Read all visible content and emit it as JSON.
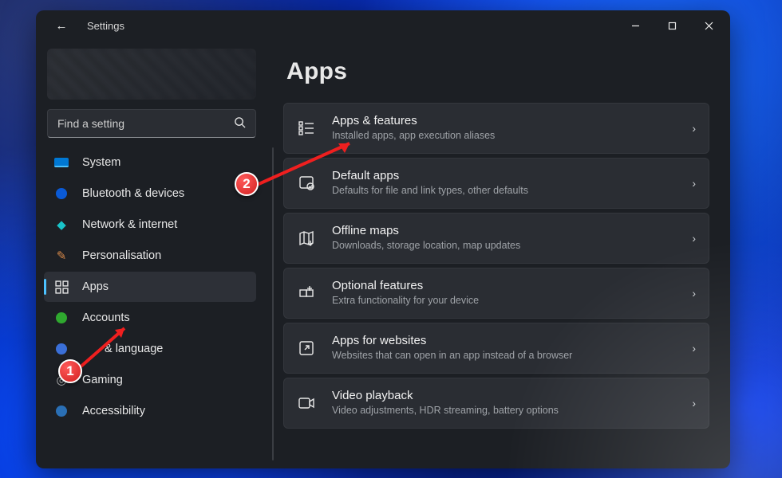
{
  "window": {
    "title": "Settings"
  },
  "search": {
    "placeholder": "Find a setting"
  },
  "sidebar": {
    "items": [
      {
        "label": "System"
      },
      {
        "label": "Bluetooth & devices"
      },
      {
        "label": "Network & internet"
      },
      {
        "label": "Personalisation"
      },
      {
        "label": "Apps"
      },
      {
        "label": "Accounts"
      },
      {
        "label": "Time & language"
      },
      {
        "label": "Gaming"
      },
      {
        "label": "Accessibility"
      }
    ],
    "partial_label_time": "& language",
    "selected_index": 4
  },
  "main": {
    "heading": "Apps",
    "cards": [
      {
        "title": "Apps & features",
        "subtitle": "Installed apps, app execution aliases"
      },
      {
        "title": "Default apps",
        "subtitle": "Defaults for file and link types, other defaults"
      },
      {
        "title": "Offline maps",
        "subtitle": "Downloads, storage location, map updates"
      },
      {
        "title": "Optional features",
        "subtitle": "Extra functionality for your device"
      },
      {
        "title": "Apps for websites",
        "subtitle": "Websites that can open in an app instead of a browser"
      },
      {
        "title": "Video playback",
        "subtitle": "Video adjustments, HDR streaming, battery options"
      }
    ]
  },
  "annotations": {
    "marker1": "1",
    "marker2": "2"
  }
}
